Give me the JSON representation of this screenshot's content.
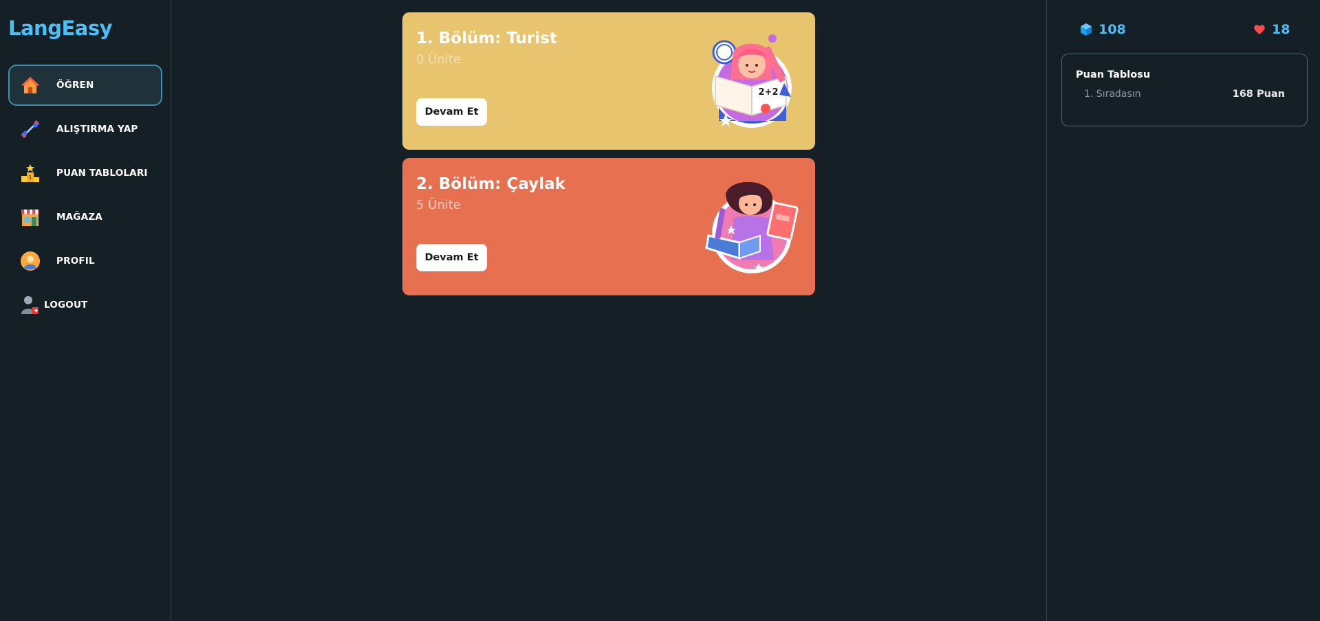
{
  "app": {
    "name": "LangEasy"
  },
  "sidebar": {
    "items": [
      {
        "label": "ÖĞREN",
        "icon": "home-icon"
      },
      {
        "label": "ALIŞTIRMA YAP",
        "icon": "dumbbell-icon"
      },
      {
        "label": "PUAN TABLOLARI",
        "icon": "podium-icon"
      },
      {
        "label": "MAĞAZA",
        "icon": "shop-icon"
      },
      {
        "label": "PROFIL",
        "icon": "profile-icon"
      },
      {
        "label": "LOGOUT",
        "icon": "logout-icon"
      }
    ]
  },
  "sections": [
    {
      "title": "1. Bölüm: Turist",
      "units": "0 Ünite",
      "button": "Devam Et",
      "color": "#e7c46d",
      "art": "girl-reading-math-book-icon"
    },
    {
      "title": "2. Bölüm: Çaylak",
      "units": "5 Ünite",
      "button": "Devam Et",
      "color": "#e6704f",
      "art": "child-reading-books-icon"
    }
  ],
  "stats": {
    "gems": "108",
    "hearts": "18"
  },
  "leaderboard": {
    "title": "Puan Tablosu",
    "rank": "1. Sıradasın",
    "points": "168 Puan"
  },
  "colors": {
    "background": "#151f26",
    "accent": "#49c0f8",
    "active_border": "#3f8fae"
  }
}
